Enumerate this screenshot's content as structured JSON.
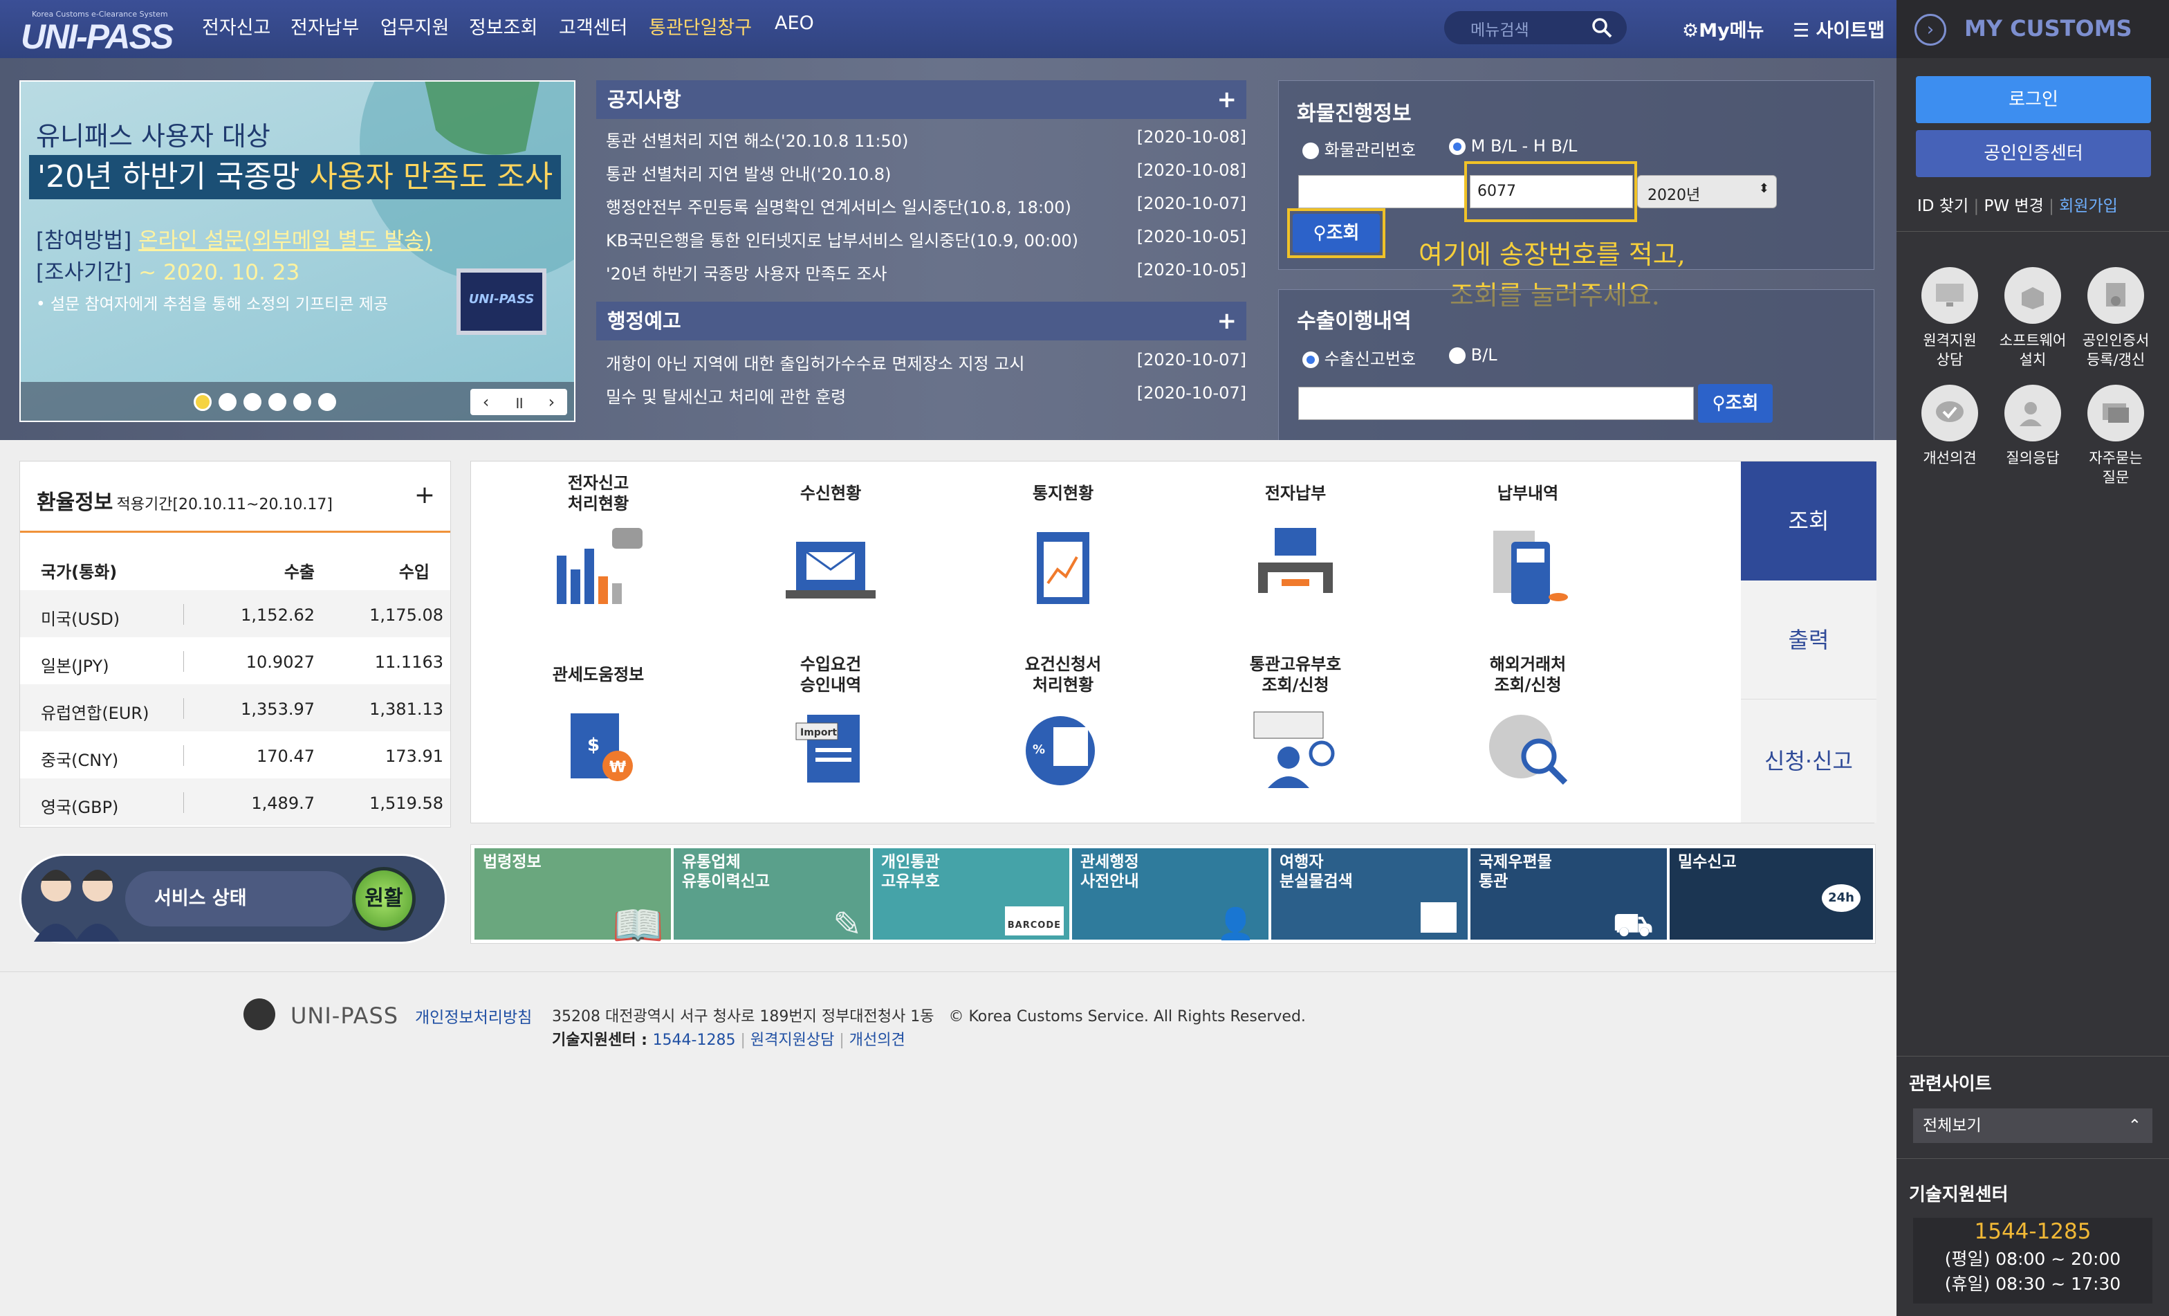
{
  "nav": {
    "logo": "UNI-PASS",
    "logo_sub": "Korea Customs e-Clearance System",
    "items": [
      "전자신고",
      "전자납부",
      "업무지원",
      "정보조회",
      "고객센터",
      "통관단일창구",
      "AEO"
    ],
    "search_placeholder": "메뉴검색",
    "mymenu": "My메뉴",
    "sitemap": "사이트맵"
  },
  "sidebar": {
    "title": "MY CUSTOMS",
    "login": "로그인",
    "cert_center": "공인인증센터",
    "links": [
      "ID 찾기",
      "PW 변경",
      "회원가입"
    ],
    "icons": [
      {
        "label": "원격지원\n상담",
        "icon": "monitor-icon"
      },
      {
        "label": "소프트웨어\n설치",
        "icon": "box-icon"
      },
      {
        "label": "공인인증서\n등록/갱신",
        "icon": "certificate-icon"
      },
      {
        "label": "개선의견",
        "icon": "check-bubble-icon"
      },
      {
        "label": "질의응답",
        "icon": "user-chat-icon"
      },
      {
        "label": "자주묻는\n질문",
        "icon": "faq-icon"
      }
    ],
    "related_title": "관련사이트",
    "related_select": "전체보기",
    "support_title": "기술지원센터",
    "support_phone": "1544-1285",
    "support_weekday": "(평일) 08:00 ~ 20:00",
    "support_holiday": "(휴일) 08:30 ~ 17:30"
  },
  "banner": {
    "line1": "유니패스 사용자 대상",
    "line2a": "'20년 하반기 국종망 ",
    "line2b": "사용자 만족도 조사",
    "method_label": "[참여방법]",
    "method_value": "온라인 설문(외부메일 별도 발송)",
    "period_label": "[조사기간]",
    "period_value": "~ 2020. 10. 23",
    "note": "• 설문 참여자에게 추첨을 통해 소정의 기프티콘 제공",
    "monitor_text": "UNI-PASS"
  },
  "notice": {
    "title": "공지사항",
    "items": [
      {
        "text": "통관 선별처리 지연 해소('20.10.8 11:50)",
        "date": "[2020-10-08]"
      },
      {
        "text": "통관 선별처리 지연 발생 안내('20.10.8)",
        "date": "[2020-10-08]"
      },
      {
        "text": "행정안전부 주민등록 실명확인 연계서비스 일시중단(10.8, 18:00)",
        "date": "[2020-10-07]"
      },
      {
        "text": "KB국민은행을 통한 인터넷지로 납부서비스 일시중단(10.9, 00:00)",
        "date": "[2020-10-05]"
      },
      {
        "text": "'20년 하반기 국종망 사용자 만족도 조사",
        "date": "[2020-10-05]"
      }
    ]
  },
  "admin": {
    "title": "행정예고",
    "items": [
      {
        "text": "개항이 아닌 지역에 대한 출입허가수수료 면제장소 지정 고시",
        "date": "[2020-10-07]"
      },
      {
        "text": "밀수 및 탈세신고 처리에 관한 훈령",
        "date": "[2020-10-07]"
      }
    ]
  },
  "cargo": {
    "title": "화물진행정보",
    "opt1": "화물관리번호",
    "opt2": "M B/L - H B/L",
    "bl_value": "6077",
    "year": "2020년",
    "search": "조회",
    "annotation1": "여기에 송장번호를 적고,",
    "annotation2": "조회를 눌러주세요."
  },
  "export": {
    "title": "수출이행내역",
    "opt1": "수출신고번호",
    "opt2": "B/L",
    "search": "조회"
  },
  "rates": {
    "title": "환율정보",
    "period": "적용기간[20.10.11~20.10.17]",
    "headers": [
      "국가(통화)",
      "수출",
      "수입"
    ],
    "rows": [
      [
        "미국(USD)",
        "1,152.62",
        "1,175.08"
      ],
      [
        "일본(JPY)",
        "10.9027",
        "11.1163"
      ],
      [
        "유럽연합(EUR)",
        "1,353.97",
        "1,381.13"
      ],
      [
        "중국(CNY)",
        "170.47",
        "173.91"
      ],
      [
        "영국(GBP)",
        "1,489.7",
        "1,519.58"
      ]
    ]
  },
  "services": {
    "items": [
      "전자신고\n처리현황",
      "수신현황",
      "통지현황",
      "전자납부",
      "납부내역",
      "관세도움정보",
      "수입요건\n승인내역",
      "요건신청서\n처리현황",
      "통관고유부호\n조회/신청",
      "해외거래처\n조회/신청"
    ],
    "tabs": [
      "조회",
      "출력",
      "신청·신고"
    ]
  },
  "status": {
    "label": "서비스 상태",
    "value": "원활"
  },
  "tiles": [
    {
      "label": "법령정보",
      "color": "#6aa77e"
    },
    {
      "label": "유통업체\n유통이력신고",
      "color": "#5aa08b"
    },
    {
      "label": "개인통관\n고유부호",
      "color": "#45a3a8",
      "extra": "BARCODE"
    },
    {
      "label": "관세행정\n사전안내",
      "color": "#2f7b9c"
    },
    {
      "label": "여행자\n분실물검색",
      "color": "#2b5f8a"
    },
    {
      "label": "국제우편물\n통관",
      "color": "#234a73"
    },
    {
      "label": "밀수신고",
      "color": "#1b3552",
      "extra": "24h"
    }
  ],
  "footer": {
    "logo": "UNI-PASS",
    "privacy": "개인정보처리방침",
    "address": "35208 대전광역시 서구 청사로 189번지 정부대전청사 1동",
    "copyright": "© Korea Customs Service. All Rights Reserved.",
    "support_label": "기술지원센터 : ",
    "support_phone": "1544-1285",
    "remote": "원격지원상담",
    "feedback": "개선의견"
  }
}
